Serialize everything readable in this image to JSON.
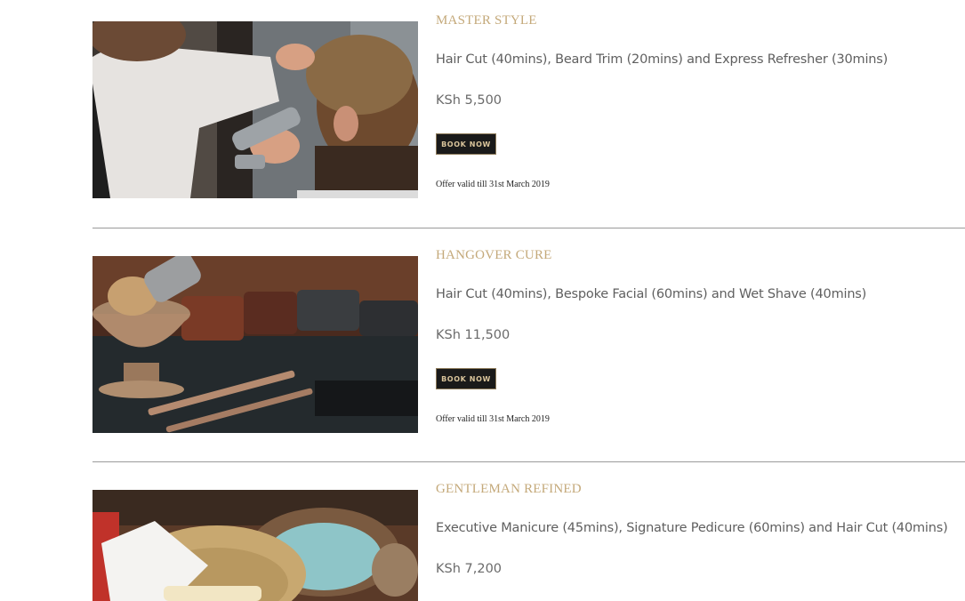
{
  "offers": [
    {
      "title": "MASTER STYLE",
      "description": "Hair Cut (40mins), Beard Trim (20mins) and Express Refresher (30mins)",
      "price": "KSh 5,500",
      "button_label": "BOOK NOW",
      "validity": "Offer valid till 31st March 2019"
    },
    {
      "title": "HANGOVER CURE",
      "description": "Hair Cut (40mins), Bespoke Facial (60mins) and Wet Shave (40mins)",
      "price": "KSh 11,500",
      "button_label": "BOOK NOW",
      "validity": "Offer valid till 31st March 2019"
    },
    {
      "title": "GENTLEMAN REFINED",
      "description": "Executive Manicure (45mins), Signature Pedicure (60mins) and Hair Cut (40mins)",
      "price": "KSh 7,200"
    }
  ],
  "colors": {
    "accent_gold": "#c4a97a",
    "button_bg": "#1a1a1a",
    "button_text": "#d9c49b",
    "body_text": "#5f5f5f"
  }
}
